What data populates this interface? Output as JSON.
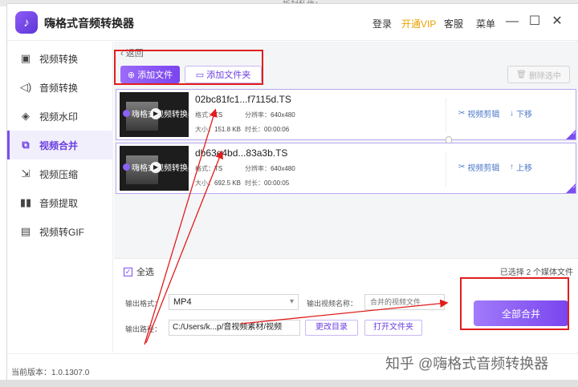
{
  "app": {
    "title": "嗨格式音频转换器",
    "background_tab": "拆封私信：",
    "top_links": [
      "登录",
      "开通VIP",
      "客服",
      "菜单"
    ],
    "accent": "#7a4ef0",
    "vip_color": "#e8a300",
    "annotation_color": "#e11d1d"
  },
  "sidebar": {
    "items": [
      {
        "label": "视频转换",
        "icon": "video-convert-icon"
      },
      {
        "label": "音频转换",
        "icon": "audio-convert-icon"
      },
      {
        "label": "视频水印",
        "icon": "watermark-icon"
      },
      {
        "label": "视频合并",
        "icon": "merge-icon",
        "active": true
      },
      {
        "label": "视频压缩",
        "icon": "compress-icon"
      },
      {
        "label": "音频提取",
        "icon": "audio-extract-icon"
      },
      {
        "label": "视频转GIF",
        "icon": "gif-icon"
      }
    ]
  },
  "toolbar": {
    "back": "返回",
    "add_file": "添加文件",
    "add_folder": "添加文件夹",
    "delete_selected": "删除选中"
  },
  "files": [
    {
      "name": "02bc81fc1...f7115d.TS",
      "format_label": "格式：",
      "format": "TS",
      "resolution_label": "分辨率：",
      "resolution": "640x480",
      "size_label": "大小：",
      "size": "151.8 KB",
      "duration_label": "时长：",
      "duration": "00:00:06",
      "edit": "视频剪辑",
      "move": "下移",
      "thumb_text": "嗨格式视频转换器"
    },
    {
      "name": "db63e4bd...83a3b.TS",
      "format_label": "格式：",
      "format": "TS",
      "resolution_label": "分辨率：",
      "resolution": "640x480",
      "size_label": "大小：",
      "size": "692.5 KB",
      "duration_label": "时长：",
      "duration": "00:00:05",
      "edit": "视频剪辑",
      "move": "上移",
      "thumb_text": "嗨格式视频转换器"
    }
  ],
  "footer_panel": {
    "select_all": "全选",
    "selected_count": "已选择 2 个媒体文件",
    "output_format_label": "输出格式：",
    "output_format": "MP4",
    "output_name_label": "输出视频名称：",
    "output_name_placeholder": "合并的视频文件",
    "output_path_label": "输出路径：",
    "output_path": "C:/Users/k...p/音视频素材/视频",
    "change_dir": "更改目录",
    "open_folder": "打开文件夹",
    "merge_all": "全部合并"
  },
  "status": {
    "version": "当前版本：1.0.1307.0"
  },
  "watermark": "知乎 @嗨格式音频转换器"
}
